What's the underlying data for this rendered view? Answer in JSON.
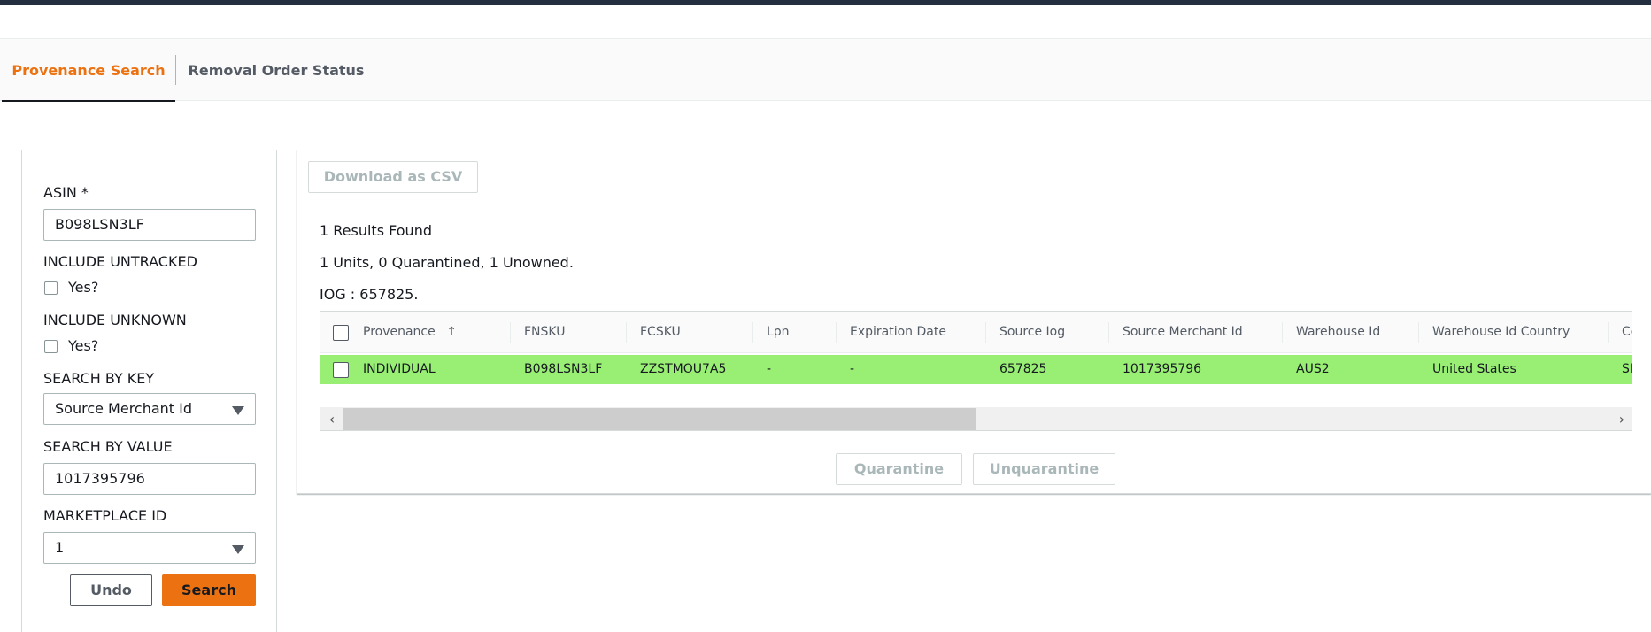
{
  "tabs": [
    {
      "label": "Provenance Search",
      "active": true
    },
    {
      "label": "Removal Order Status",
      "active": false
    }
  ],
  "form": {
    "asin_label": "ASIN *",
    "asin_value": "B098LSN3LF",
    "include_untracked_label": "INCLUDE UNTRACKED",
    "include_untracked_option": "Yes?",
    "include_unknown_label": "INCLUDE UNKNOWN",
    "include_unknown_option": "Yes?",
    "search_key_label": "SEARCH BY KEY",
    "search_key_value": "Source Merchant Id",
    "search_value_label": "SEARCH BY VALUE",
    "search_value_value": "1017395796",
    "marketplace_label": "MARKETPLACE ID",
    "marketplace_value": "1",
    "undo_label": "Undo",
    "search_label": "Search"
  },
  "results": {
    "download_label": "Download as CSV",
    "count_text": "1 Results Found",
    "summary_text": "1 Units, 0 Quarantined, 1 Unowned.",
    "iog_text": "IOG : 657825.",
    "sort_icon": "arrow-up-icon",
    "columns": [
      "Provenance",
      "FNSKU",
      "FCSKU",
      "Lpn",
      "Expiration Date",
      "Source Iog",
      "Source Merchant Id",
      "Warehouse Id",
      "Warehouse Id Country",
      "Co"
    ],
    "rows": [
      [
        "INDIVIDUAL",
        "B098LSN3LF",
        "ZZSTMOU7A5",
        "-",
        "-",
        "657825",
        "1017395796",
        "AUS2",
        "United States",
        "SE"
      ]
    ],
    "row_highlight_color": "#98ef73",
    "quarantine_label": "Quarantine",
    "unquarantine_label": "Unquarantine"
  },
  "colors": {
    "accent": "#ec7211",
    "topbar": "#232f3e"
  }
}
